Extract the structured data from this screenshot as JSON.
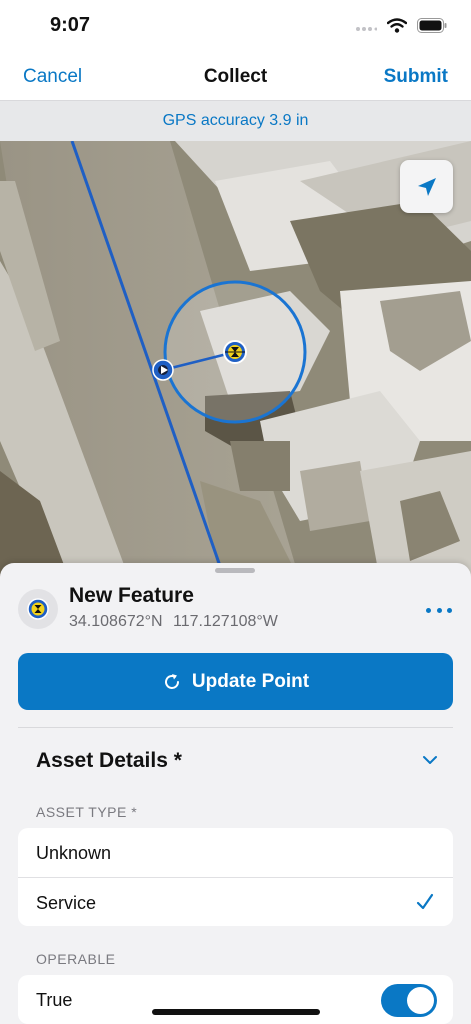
{
  "status_bar": {
    "time": "9:07",
    "icons": [
      "signal-icon",
      "wifi-icon",
      "battery-icon"
    ]
  },
  "nav": {
    "cancel_label": "Cancel",
    "title": "Collect",
    "submit_label": "Submit"
  },
  "gps": {
    "accuracy_text": "GPS accuracy 3.9 in"
  },
  "map": {
    "locate_icon": "location-arrow-icon",
    "line_color": "#1f5fc4",
    "accuracy_circle_color": "#1a74d2"
  },
  "feature": {
    "icon": "feature-symbol-icon",
    "title": "New Feature",
    "latitude": "34.108672°N",
    "longitude": "117.127108°W",
    "more_icon": "ellipsis-icon"
  },
  "update_button": {
    "icon": "refresh-icon",
    "label": "Update Point"
  },
  "asset_details": {
    "title": "Asset Details *",
    "chevron_icon": "chevron-down-icon"
  },
  "asset_type": {
    "label": "ASSET TYPE *",
    "options": [
      "Unknown",
      "Service"
    ],
    "selected": "Service",
    "check_icon": "checkmark-icon"
  },
  "operable": {
    "label": "OPERABLE",
    "value_label": "True",
    "value": true
  },
  "colors": {
    "accent": "#0a78c5",
    "background": "#f2f2f4"
  }
}
